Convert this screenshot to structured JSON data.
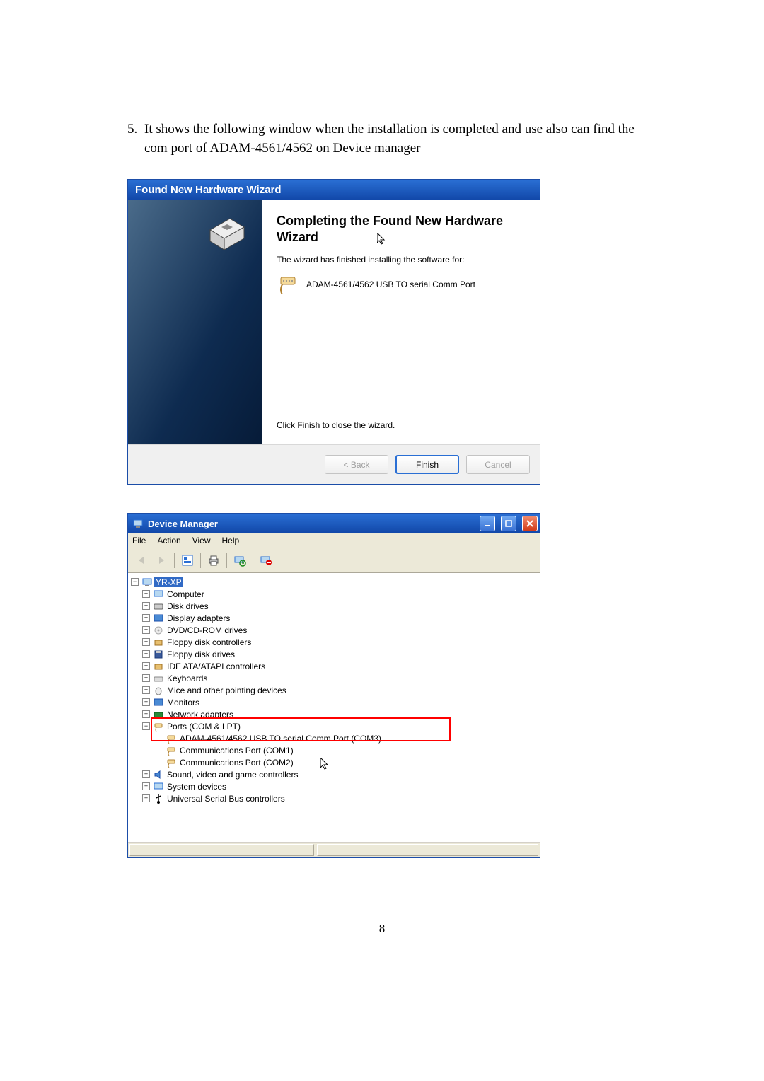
{
  "instruction": {
    "number": "5.",
    "text": "It shows the following window when the installation is completed and use also can find the com port of ADAM-4561/4562 on Device manager"
  },
  "wizard": {
    "title": "Found New Hardware Wizard",
    "heading": "Completing the Found New Hardware Wizard",
    "desc": "The wizard has finished installing the software for:",
    "device_name": "ADAM-4561/4562 USB TO serial Comm Port",
    "close_text": "Click Finish to close the wizard.",
    "buttons": {
      "back": "< Back",
      "finish": "Finish",
      "cancel": "Cancel"
    }
  },
  "device_manager": {
    "title": "Device Manager",
    "menu": [
      "File",
      "Action",
      "View",
      "Help"
    ],
    "root": "YR-XP",
    "categories": [
      "Computer",
      "Disk drives",
      "Display adapters",
      "DVD/CD-ROM drives",
      "Floppy disk controllers",
      "Floppy disk drives",
      "IDE ATA/ATAPI controllers",
      "Keyboards",
      "Mice and other pointing devices",
      "Monitors",
      "Network adapters"
    ],
    "ports_label": "Ports (COM & LPT)",
    "ports_children": [
      "ADAM-4561/4562 USB TO serial Comm Port (COM3)",
      "Communications Port (COM1)",
      "Communications Port (COM2)"
    ],
    "post_ports": [
      "Sound, video and game controllers",
      "System devices",
      "Universal Serial Bus controllers"
    ]
  },
  "page_number": "8"
}
